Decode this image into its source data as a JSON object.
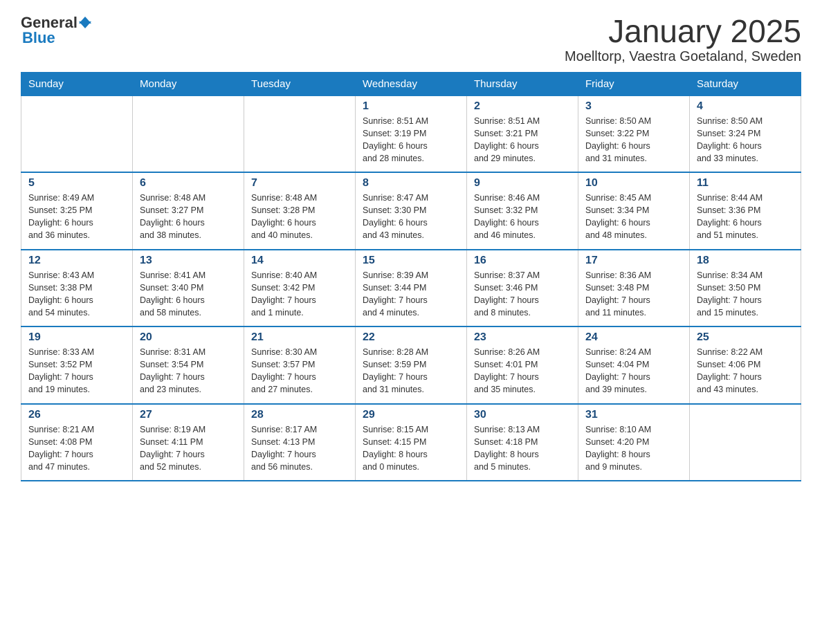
{
  "logo": {
    "general": "General",
    "blue": "Blue"
  },
  "title": "January 2025",
  "subtitle": "Moelltorp, Vaestra Goetaland, Sweden",
  "days_of_week": [
    "Sunday",
    "Monday",
    "Tuesday",
    "Wednesday",
    "Thursday",
    "Friday",
    "Saturday"
  ],
  "weeks": [
    [
      {
        "day": "",
        "info": ""
      },
      {
        "day": "",
        "info": ""
      },
      {
        "day": "",
        "info": ""
      },
      {
        "day": "1",
        "info": "Sunrise: 8:51 AM\nSunset: 3:19 PM\nDaylight: 6 hours\nand 28 minutes."
      },
      {
        "day": "2",
        "info": "Sunrise: 8:51 AM\nSunset: 3:21 PM\nDaylight: 6 hours\nand 29 minutes."
      },
      {
        "day": "3",
        "info": "Sunrise: 8:50 AM\nSunset: 3:22 PM\nDaylight: 6 hours\nand 31 minutes."
      },
      {
        "day": "4",
        "info": "Sunrise: 8:50 AM\nSunset: 3:24 PM\nDaylight: 6 hours\nand 33 minutes."
      }
    ],
    [
      {
        "day": "5",
        "info": "Sunrise: 8:49 AM\nSunset: 3:25 PM\nDaylight: 6 hours\nand 36 minutes."
      },
      {
        "day": "6",
        "info": "Sunrise: 8:48 AM\nSunset: 3:27 PM\nDaylight: 6 hours\nand 38 minutes."
      },
      {
        "day": "7",
        "info": "Sunrise: 8:48 AM\nSunset: 3:28 PM\nDaylight: 6 hours\nand 40 minutes."
      },
      {
        "day": "8",
        "info": "Sunrise: 8:47 AM\nSunset: 3:30 PM\nDaylight: 6 hours\nand 43 minutes."
      },
      {
        "day": "9",
        "info": "Sunrise: 8:46 AM\nSunset: 3:32 PM\nDaylight: 6 hours\nand 46 minutes."
      },
      {
        "day": "10",
        "info": "Sunrise: 8:45 AM\nSunset: 3:34 PM\nDaylight: 6 hours\nand 48 minutes."
      },
      {
        "day": "11",
        "info": "Sunrise: 8:44 AM\nSunset: 3:36 PM\nDaylight: 6 hours\nand 51 minutes."
      }
    ],
    [
      {
        "day": "12",
        "info": "Sunrise: 8:43 AM\nSunset: 3:38 PM\nDaylight: 6 hours\nand 54 minutes."
      },
      {
        "day": "13",
        "info": "Sunrise: 8:41 AM\nSunset: 3:40 PM\nDaylight: 6 hours\nand 58 minutes."
      },
      {
        "day": "14",
        "info": "Sunrise: 8:40 AM\nSunset: 3:42 PM\nDaylight: 7 hours\nand 1 minute."
      },
      {
        "day": "15",
        "info": "Sunrise: 8:39 AM\nSunset: 3:44 PM\nDaylight: 7 hours\nand 4 minutes."
      },
      {
        "day": "16",
        "info": "Sunrise: 8:37 AM\nSunset: 3:46 PM\nDaylight: 7 hours\nand 8 minutes."
      },
      {
        "day": "17",
        "info": "Sunrise: 8:36 AM\nSunset: 3:48 PM\nDaylight: 7 hours\nand 11 minutes."
      },
      {
        "day": "18",
        "info": "Sunrise: 8:34 AM\nSunset: 3:50 PM\nDaylight: 7 hours\nand 15 minutes."
      }
    ],
    [
      {
        "day": "19",
        "info": "Sunrise: 8:33 AM\nSunset: 3:52 PM\nDaylight: 7 hours\nand 19 minutes."
      },
      {
        "day": "20",
        "info": "Sunrise: 8:31 AM\nSunset: 3:54 PM\nDaylight: 7 hours\nand 23 minutes."
      },
      {
        "day": "21",
        "info": "Sunrise: 8:30 AM\nSunset: 3:57 PM\nDaylight: 7 hours\nand 27 minutes."
      },
      {
        "day": "22",
        "info": "Sunrise: 8:28 AM\nSunset: 3:59 PM\nDaylight: 7 hours\nand 31 minutes."
      },
      {
        "day": "23",
        "info": "Sunrise: 8:26 AM\nSunset: 4:01 PM\nDaylight: 7 hours\nand 35 minutes."
      },
      {
        "day": "24",
        "info": "Sunrise: 8:24 AM\nSunset: 4:04 PM\nDaylight: 7 hours\nand 39 minutes."
      },
      {
        "day": "25",
        "info": "Sunrise: 8:22 AM\nSunset: 4:06 PM\nDaylight: 7 hours\nand 43 minutes."
      }
    ],
    [
      {
        "day": "26",
        "info": "Sunrise: 8:21 AM\nSunset: 4:08 PM\nDaylight: 7 hours\nand 47 minutes."
      },
      {
        "day": "27",
        "info": "Sunrise: 8:19 AM\nSunset: 4:11 PM\nDaylight: 7 hours\nand 52 minutes."
      },
      {
        "day": "28",
        "info": "Sunrise: 8:17 AM\nSunset: 4:13 PM\nDaylight: 7 hours\nand 56 minutes."
      },
      {
        "day": "29",
        "info": "Sunrise: 8:15 AM\nSunset: 4:15 PM\nDaylight: 8 hours\nand 0 minutes."
      },
      {
        "day": "30",
        "info": "Sunrise: 8:13 AM\nSunset: 4:18 PM\nDaylight: 8 hours\nand 5 minutes."
      },
      {
        "day": "31",
        "info": "Sunrise: 8:10 AM\nSunset: 4:20 PM\nDaylight: 8 hours\nand 9 minutes."
      },
      {
        "day": "",
        "info": ""
      }
    ]
  ]
}
